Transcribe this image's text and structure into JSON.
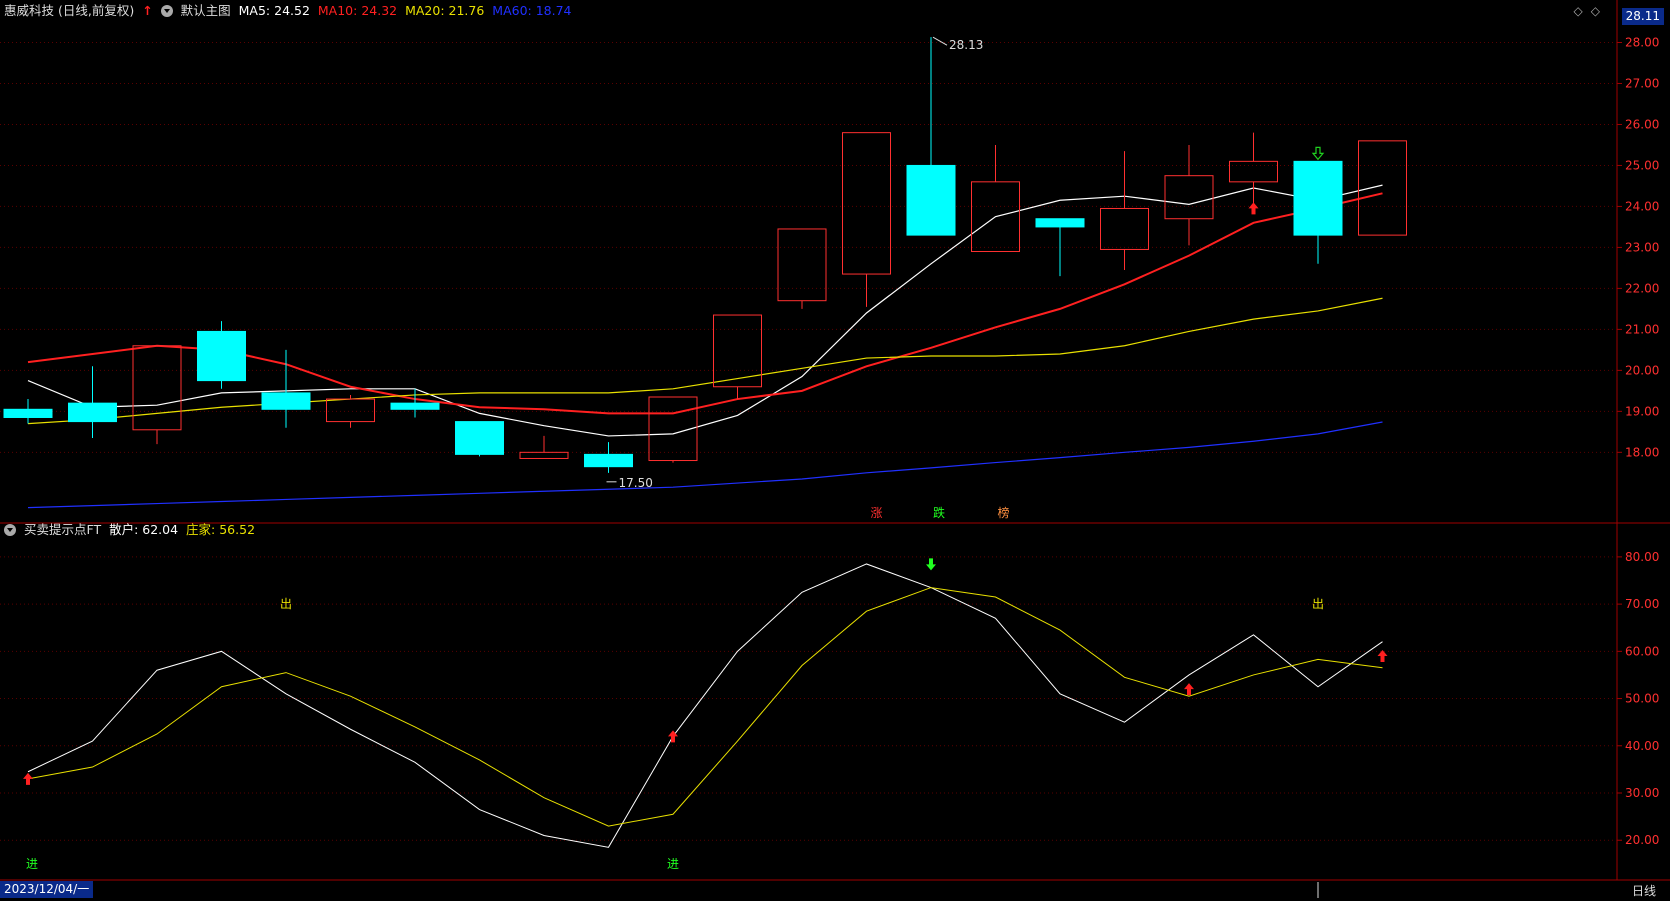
{
  "header": {
    "stock_name": "惠威科技 (日线,前复权)",
    "main_chart_label": "默认主图",
    "ma5": "MA5: 24.52",
    "ma10": "MA10: 24.32",
    "ma20": "MA20: 21.76",
    "ma60": "MA60: 18.74",
    "colors": {
      "ma5": "#ffffff",
      "ma10": "#ff2020",
      "ma20": "#e8e000",
      "ma60": "#2030ff"
    }
  },
  "top_right_price": "28.11",
  "main_axis": {
    "ticks": [
      "28.00",
      "27.00",
      "26.00",
      "25.00",
      "24.00",
      "23.00",
      "22.00",
      "21.00",
      "20.00",
      "19.00",
      "18.00"
    ]
  },
  "annotations": {
    "high_label": "28.13",
    "low_label": "17.50",
    "bottom_markers": [
      "涨",
      "跌",
      "榜"
    ]
  },
  "indicator": {
    "title": "买卖提示点FT",
    "retail": "散户: 62.04",
    "dealer": "庄家: 56.52",
    "ticks": [
      "80.00",
      "70.00",
      "60.00",
      "50.00",
      "40.00",
      "30.00",
      "20.00"
    ],
    "labels": {
      "out": "出",
      "in": "进"
    }
  },
  "footer": {
    "date": "2023/12/04/一",
    "period": "日线"
  },
  "chart_data": {
    "type": "candlestick",
    "ylim": [
      16.3,
      28.5
    ],
    "candles": [
      {
        "o": 19.05,
        "c": 18.85,
        "h": 19.3,
        "l": 18.7
      },
      {
        "o": 19.2,
        "c": 18.75,
        "h": 20.1,
        "l": 18.35
      },
      {
        "o": 18.55,
        "c": 20.6,
        "h": 20.6,
        "l": 18.2
      },
      {
        "o": 20.95,
        "c": 19.75,
        "h": 21.2,
        "l": 19.55
      },
      {
        "o": 19.45,
        "c": 19.05,
        "h": 20.5,
        "l": 18.6
      },
      {
        "o": 18.75,
        "c": 19.3,
        "h": 19.4,
        "l": 18.6
      },
      {
        "o": 19.2,
        "c": 19.05,
        "h": 19.55,
        "l": 18.85
      },
      {
        "o": 18.75,
        "c": 17.95,
        "h": 18.75,
        "l": 17.9
      },
      {
        "o": 17.85,
        "c": 18.0,
        "h": 18.4,
        "l": 17.85
      },
      {
        "o": 17.95,
        "c": 17.65,
        "h": 18.25,
        "l": 17.5
      },
      {
        "o": 17.8,
        "c": 19.35,
        "h": 19.35,
        "l": 17.75
      },
      {
        "o": 19.6,
        "c": 21.35,
        "h": 21.35,
        "l": 19.3
      },
      {
        "o": 21.7,
        "c": 23.45,
        "h": 23.45,
        "l": 21.5
      },
      {
        "o": 22.35,
        "c": 25.8,
        "h": 25.8,
        "l": 21.55
      },
      {
        "o": 25.0,
        "c": 23.3,
        "h": 28.13,
        "l": 23.3
      },
      {
        "o": 22.9,
        "c": 24.6,
        "h": 25.5,
        "l": 22.9
      },
      {
        "o": 23.7,
        "c": 23.5,
        "h": 23.7,
        "l": 22.3
      },
      {
        "o": 22.95,
        "c": 23.95,
        "h": 25.35,
        "l": 22.45
      },
      {
        "o": 23.7,
        "c": 24.75,
        "h": 25.5,
        "l": 23.05
      },
      {
        "o": 24.6,
        "c": 25.1,
        "h": 25.8,
        "l": 24.0
      },
      {
        "o": 25.1,
        "c": 23.3,
        "h": 25.1,
        "l": 22.6
      },
      {
        "o": 23.3,
        "c": 25.6,
        "h": 25.6,
        "l": 23.3
      }
    ],
    "series": [
      {
        "name": "MA5",
        "values": [
          19.75,
          19.1,
          19.15,
          19.45,
          19.5,
          19.55,
          19.55,
          18.95,
          18.65,
          18.4,
          18.45,
          18.9,
          19.85,
          21.4,
          22.6,
          23.75,
          24.15,
          24.25,
          24.05,
          24.45,
          24.15,
          24.52
        ]
      },
      {
        "name": "MA10",
        "values": [
          20.2,
          20.4,
          20.6,
          20.5,
          20.15,
          19.6,
          19.3,
          19.1,
          19.05,
          18.95,
          18.95,
          19.3,
          19.5,
          20.1,
          20.55,
          21.05,
          21.5,
          22.1,
          22.8,
          23.6,
          23.95,
          24.32
        ]
      },
      {
        "name": "MA20",
        "values": [
          18.7,
          18.8,
          18.95,
          19.1,
          19.2,
          19.3,
          19.4,
          19.45,
          19.45,
          19.45,
          19.55,
          19.8,
          20.05,
          20.3,
          20.35,
          20.35,
          20.4,
          20.6,
          20.95,
          21.25,
          21.45,
          21.76
        ]
      },
      {
        "name": "MA60",
        "values": [
          16.65,
          16.7,
          16.75,
          16.8,
          16.85,
          16.9,
          16.95,
          17.0,
          17.05,
          17.1,
          17.15,
          17.25,
          17.35,
          17.5,
          17.62,
          17.75,
          17.87,
          18.0,
          18.12,
          18.27,
          18.45,
          18.74
        ]
      }
    ],
    "indicator": {
      "ylim": [
        12,
        84
      ],
      "series": [
        {
          "name": "散户",
          "values": [
            34.5,
            41,
            56,
            60,
            51,
            43.5,
            36.5,
            26.5,
            21,
            18.5,
            42,
            60,
            72.5,
            78.5,
            73.5,
            67,
            51,
            45,
            55,
            63.5,
            52.5,
            62.04
          ]
        },
        {
          "name": "庄家",
          "values": [
            33,
            35.5,
            42.5,
            52.5,
            55.5,
            50.5,
            44,
            37,
            29,
            23,
            25.5,
            41,
            57,
            68.5,
            73.5,
            71.5,
            64.5,
            54.5,
            50.5,
            55,
            58.3,
            56.52
          ]
        }
      ]
    }
  }
}
